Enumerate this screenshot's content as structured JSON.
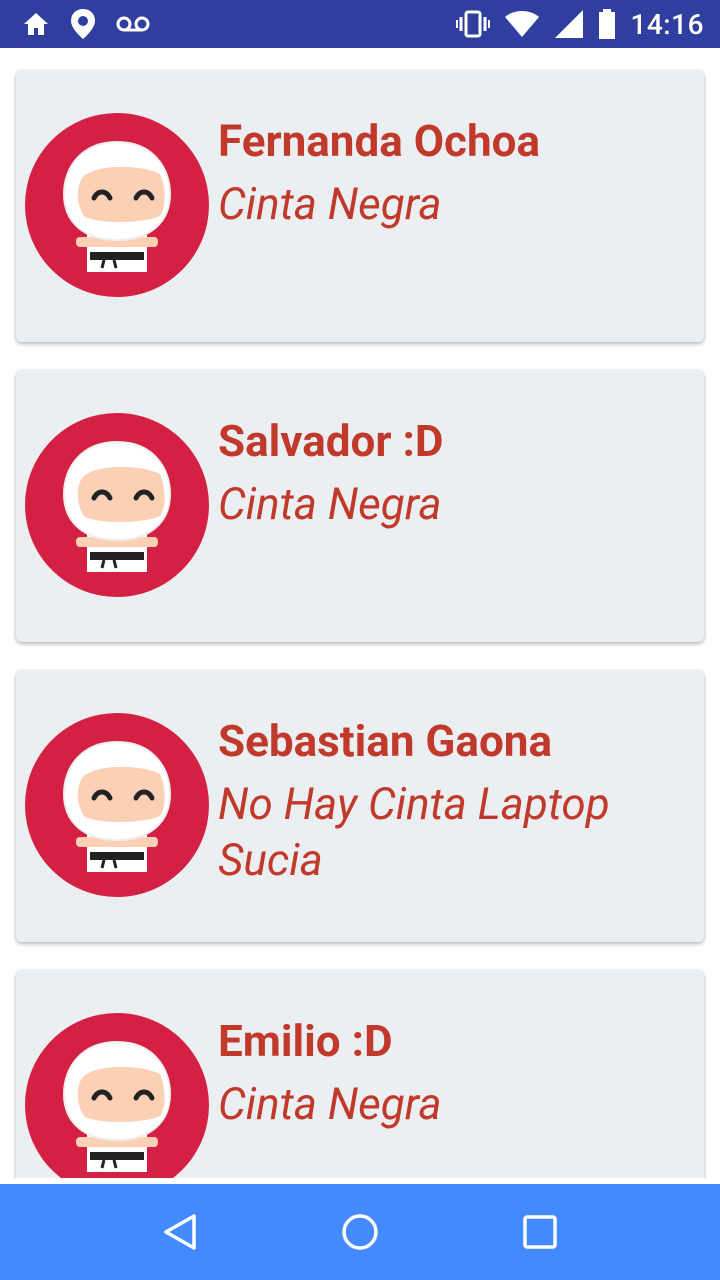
{
  "status_bar": {
    "time": "14:16",
    "left_icons": [
      "home-icon",
      "location-pin-icon",
      "voicemail-icon"
    ],
    "right_icons": [
      "vibrate-icon",
      "wifi-icon",
      "signal-icon",
      "battery-icon"
    ]
  },
  "students": [
    {
      "name": "Fernanda Ochoa",
      "belt": "Cinta Negra"
    },
    {
      "name": "Salvador :D",
      "belt": "Cinta Negra"
    },
    {
      "name": "Sebastian Gaona",
      "belt": "No Hay Cinta Laptop Sucia"
    },
    {
      "name": "Emilio :D",
      "belt": "Cinta Negra"
    }
  ],
  "nav_bar": {
    "buttons": [
      "back-icon",
      "home-circle-icon",
      "recents-icon"
    ]
  },
  "colors": {
    "status_bar": "#303f9f",
    "card_background": "#eceff1",
    "text_accent": "#c0392b",
    "avatar_circle": "#d32043",
    "nav_bar": "#448aff"
  }
}
